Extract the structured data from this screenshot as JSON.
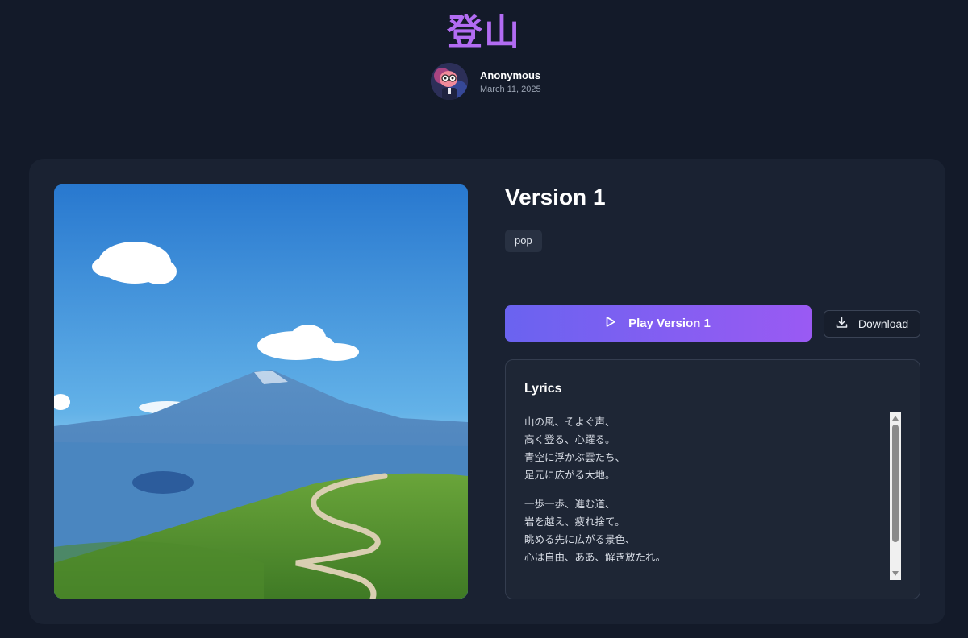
{
  "song": {
    "title": "登山"
  },
  "author": {
    "name": "Anonymous",
    "date": "March 11, 2025"
  },
  "version": {
    "title": "Version 1",
    "tags": [
      "pop"
    ],
    "play_label": "Play Version 1",
    "download_label": "Download"
  },
  "lyrics": {
    "heading": "Lyrics",
    "stanzas": [
      [
        "山の風、そよぐ声、",
        "高く登る、心躍る。",
        "青空に浮かぶ雲たち、",
        "足元に広がる大地。"
      ],
      [
        "一歩一歩、進む道、",
        "岩を越え、疲れ捨て。",
        "眺める先に広がる景色、",
        "心は自由、ああ、解き放たれ。"
      ]
    ]
  },
  "colors": {
    "background": "#131a29",
    "card": "#1a2232",
    "title_accent": "#b26cf2",
    "play_gradient_start": "#6a63f0",
    "play_gradient_end": "#9a5af3"
  },
  "icons": {
    "play": "play-icon",
    "download": "download-icon",
    "scroll_up": "chevron-up-icon",
    "scroll_down": "chevron-down-icon"
  }
}
